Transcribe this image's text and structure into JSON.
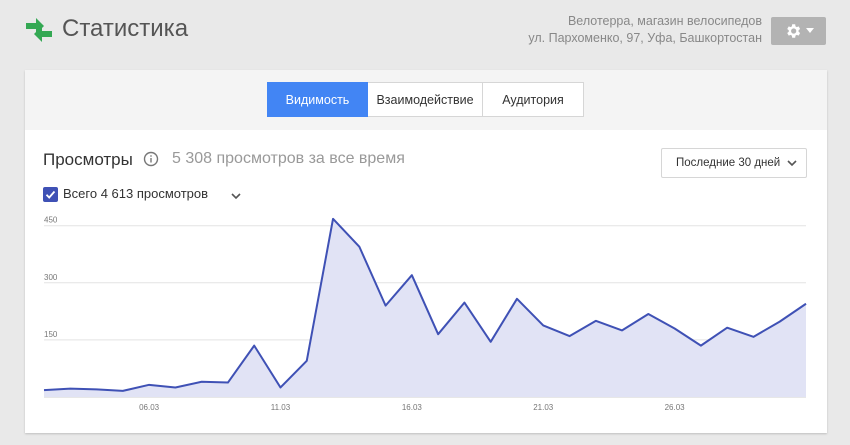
{
  "header": {
    "title": "Статистика",
    "business_name": "Велотерра, магазин велосипедов",
    "business_address": "ул. Пархоменко, 97, Уфа, Башкортостан",
    "settings_icon": "gear-icon"
  },
  "tabs": [
    {
      "label": "Видимость",
      "active": true
    },
    {
      "label": "Взаимодействие",
      "active": false
    },
    {
      "label": "Аудитория",
      "active": false
    }
  ],
  "views": {
    "title": "Просмотры",
    "total_label": "5 308 просмотров за все время",
    "period_label": "Последние 30 дней",
    "series_label": "Всего 4 613 просмотров",
    "series_checked": true
  },
  "colors": {
    "accent": "#4285f4",
    "series_line": "#3f51b5",
    "series_fill": "#e1e3f5"
  },
  "chart_data": {
    "type": "area",
    "x": [
      "02.03",
      "03.03",
      "04.03",
      "05.03",
      "06.03",
      "07.03",
      "08.03",
      "09.03",
      "10.03",
      "11.03",
      "12.03",
      "13.03",
      "14.03",
      "15.03",
      "16.03",
      "17.03",
      "18.03",
      "19.03",
      "20.03",
      "21.03",
      "22.03",
      "23.03",
      "24.03",
      "25.03",
      "26.03",
      "27.03",
      "28.03",
      "29.03",
      "30.03",
      "31.03"
    ],
    "x_tick_labels": [
      "06.03",
      "11.03",
      "16.03",
      "21.03",
      "26.03"
    ],
    "x_tick_index": [
      4,
      9,
      14,
      19,
      24
    ],
    "y_ticks": [
      150,
      300,
      450
    ],
    "ylim": [
      0,
      465
    ],
    "values": [
      18,
      22,
      20,
      16,
      32,
      25,
      40,
      38,
      135,
      25,
      95,
      468,
      395,
      240,
      320,
      165,
      248,
      145,
      258,
      188,
      160,
      200,
      175,
      218,
      180,
      135,
      182,
      158,
      198,
      245
    ],
    "grid": true
  }
}
